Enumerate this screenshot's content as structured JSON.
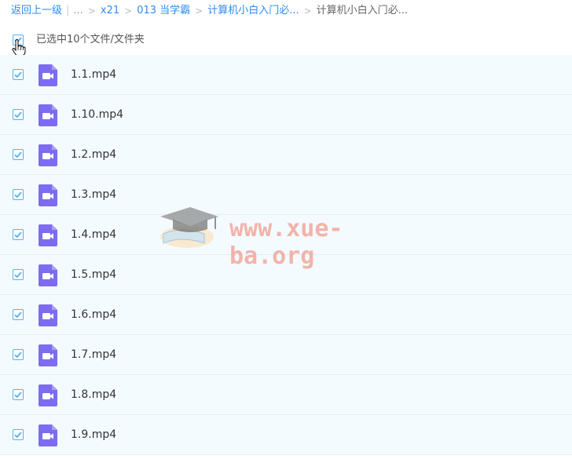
{
  "breadcrumb": {
    "back": "返回上一级",
    "ellipsis": "...",
    "items": [
      "x21",
      "013 当学霸",
      "计算机小白入门必..."
    ],
    "current": "计算机小白入门必..."
  },
  "selection": {
    "text": "已选中10个文件/文件夹"
  },
  "files": [
    {
      "name": "1.1.mp4"
    },
    {
      "name": "1.10.mp4"
    },
    {
      "name": "1.2.mp4"
    },
    {
      "name": "1.3.mp4"
    },
    {
      "name": "1.4.mp4"
    },
    {
      "name": "1.5.mp4"
    },
    {
      "name": "1.6.mp4"
    },
    {
      "name": "1.7.mp4"
    },
    {
      "name": "1.8.mp4"
    },
    {
      "name": "1.9.mp4"
    }
  ],
  "watermark": {
    "text": "www.xue-ba.org"
  },
  "colors": {
    "accent": "#2d8cf0",
    "checkbox": "#4fb1f5",
    "video_icon": "#7b6cf0",
    "row_bg": "#f4fbff"
  }
}
